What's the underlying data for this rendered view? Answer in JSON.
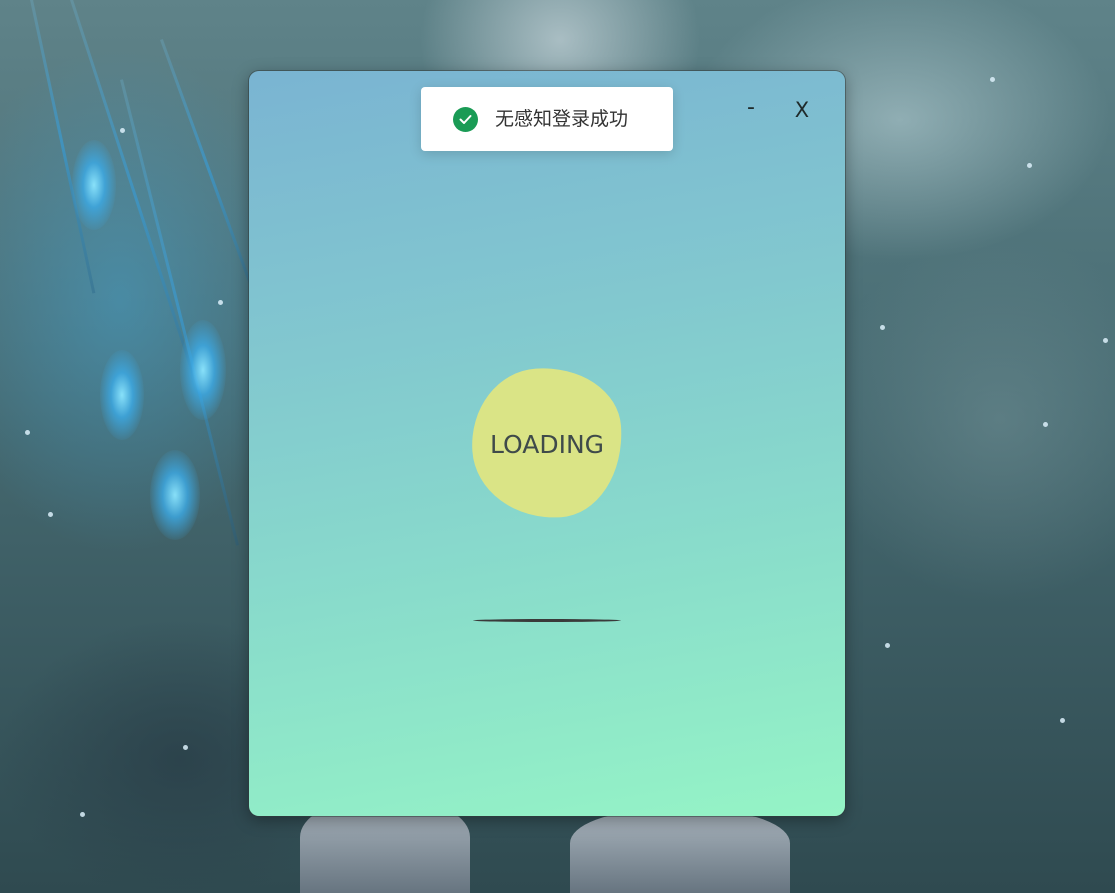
{
  "toast": {
    "message": "无感知登录成功",
    "icon": "check-circle-icon",
    "icon_color": "#1a9b55"
  },
  "window": {
    "minimize_label": "-",
    "close_label": "X",
    "gradient_top": "#7ab4d2",
    "gradient_bottom": "#95f4c6"
  },
  "loader": {
    "text": "LOADING",
    "blob_color": "#dae486"
  }
}
